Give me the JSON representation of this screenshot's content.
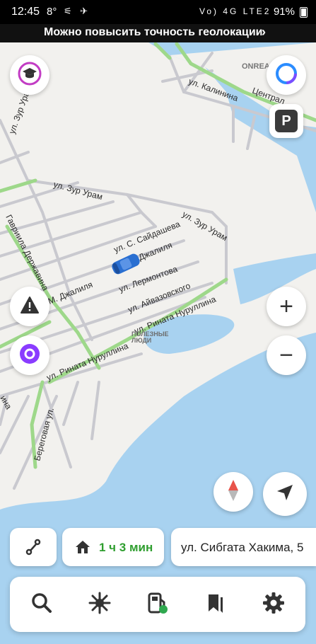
{
  "status_bar": {
    "time": "12:45",
    "temperature": "8°",
    "signal_text": "Vo) 4G LTE2",
    "battery": "91%"
  },
  "banner": {
    "text": "Можно повысить точность геолокации",
    "watermark": "ONREALT"
  },
  "map": {
    "streets": [
      {
        "name": "ул. Калинина"
      },
      {
        "name": "Централ"
      },
      {
        "name": "ул. Зур Урам"
      },
      {
        "name": "ул. Зур Урам"
      },
      {
        "name": "ул. Зур Урам"
      },
      {
        "name": "ул. С. Сайдашева"
      },
      {
        "name": "Джалиля"
      },
      {
        "name": "ул. Лермонтова"
      },
      {
        "name": "ул. Айвазовского"
      },
      {
        "name": "ул. Рината Нуруллина"
      },
      {
        "name": "ул. Рината Нуруллина"
      },
      {
        "name": "М. Джалиля"
      },
      {
        "name": "Гавриила Державина"
      },
      {
        "name": "Береговая ул."
      },
      {
        "name": "ина"
      }
    ],
    "poi_sign": {
      "line1": "ПОЛЕЗНЫЕ",
      "line2": "ЛЮДИ"
    },
    "colors": {
      "water": "#a8d2f0",
      "land": "#f2f1ee",
      "road": "#c9c9cf",
      "main_road": "#9ed88a",
      "car": "#2a6fd1"
    }
  },
  "controls": {
    "zoom_in_label": "+",
    "zoom_out_label": "−",
    "parking_label": "P",
    "icons": [
      "graduation-cap-icon",
      "alice-icon",
      "parking-icon",
      "warning-icon",
      "alice-icon",
      "zoom-in-icon",
      "zoom-out-icon",
      "compass-icon",
      "locate-icon"
    ]
  },
  "route_bar": {
    "route_time": "1 ч 3 мин",
    "destination": "ул. Сибгата Хакима, 5",
    "icons": [
      "routes-icon",
      "home-icon"
    ]
  },
  "toolbar": {
    "icons": [
      "search-icon",
      "discovery-icon",
      "fuel-icon",
      "bookmark-icon",
      "settings-icon"
    ]
  }
}
